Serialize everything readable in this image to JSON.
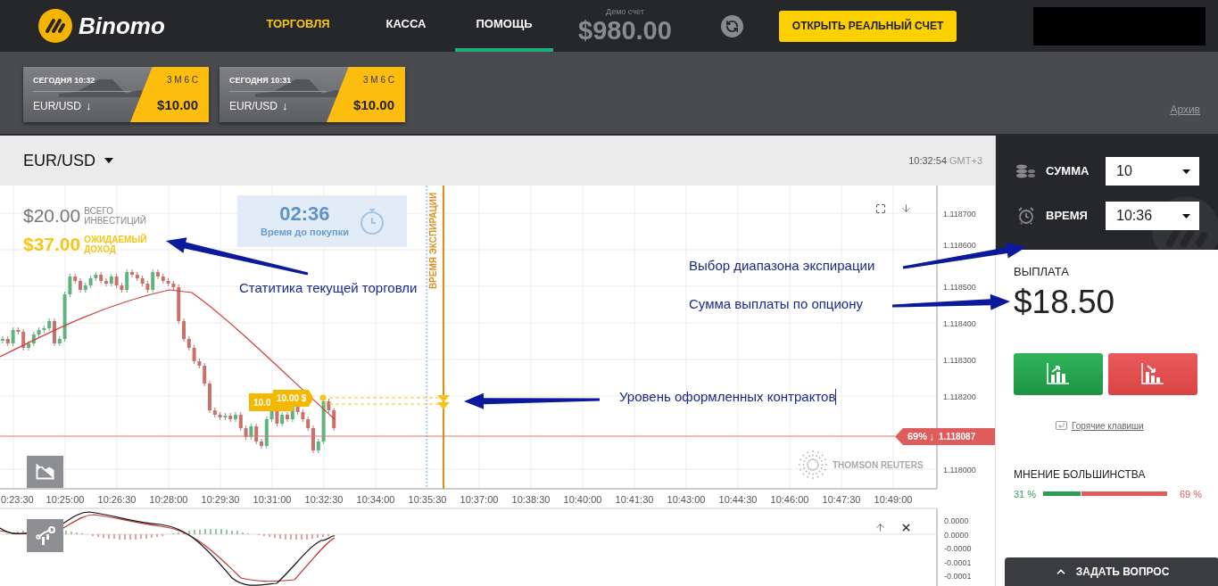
{
  "header": {
    "logo_text": "Binomo",
    "nav": [
      {
        "label": "ТОРГОВЛЯ",
        "highlighted": true,
        "selected": false
      },
      {
        "label": "КАССА",
        "highlighted": false,
        "selected": false
      },
      {
        "label": "ПОМОЩЬ",
        "highlighted": false,
        "selected": true
      }
    ],
    "account": {
      "label": "Демо счет",
      "balance": "$980.00"
    },
    "cta": "ОТКРЫТЬ РЕАЛЬНЫЙ СЧЕТ"
  },
  "open_trades": [
    {
      "time": "СЕГОДНЯ 10:32",
      "duration": "3 М 6 С",
      "asset": "EUR/USD",
      "arrow": "↓",
      "amount": "$10.00"
    },
    {
      "time": "СЕГОДНЯ 10:31",
      "duration": "3 М 6 С",
      "asset": "EUR/USD",
      "arrow": "↓",
      "amount": "$10.00"
    }
  ],
  "archive_link": "Архив",
  "chart": {
    "asset": "EUR/USD",
    "clock": "10:32:54",
    "timezone": "GMT+3",
    "investment": {
      "amount": "$20.00",
      "label": "ВСЕГО ИНВЕСТИЦИЙ"
    },
    "expected": {
      "amount": "$37.00",
      "label": "ОЖИДАЕМЫЙ ДОХОД"
    },
    "timer": {
      "value": "02:36",
      "label": "Время до покупки"
    },
    "expiry_label": "ВРЕМЯ ЭКСПИРАЦИИ",
    "contract_tags": [
      "10.0",
      "10.00 $"
    ],
    "price_tag": {
      "percent": "69%",
      "arrow": "↓",
      "price": "1.118087"
    },
    "provider": "THOMSON REUTERS",
    "price_axis": [
      "1.118700",
      "1.118600",
      "1.118500",
      "1.118400",
      "1.118300",
      "1.118200",
      "1.118000"
    ],
    "time_axis": [
      "0:23:30",
      "10:25:00",
      "10:26:30",
      "10:28:00",
      "10:29:30",
      "10:31:00",
      "10:32:30",
      "10:34:00",
      "10:35:30",
      "10:37:00",
      "10:38:30",
      "10:40:00",
      "10:41:30",
      "10:43:00",
      "10:44:30",
      "10:46:00",
      "10:47:30",
      "10:49:00"
    ],
    "indicator_axis": [
      "0.0000",
      "0.0000",
      "-0.0000",
      "-0.0001",
      "-0.0001"
    ]
  },
  "trade_panel": {
    "amount": {
      "label": "СУММА",
      "value": "10"
    },
    "time": {
      "label": "ВРЕМЯ",
      "value": "10:36"
    },
    "payout_label": "ВЫПЛАТА",
    "payout": "$18.50",
    "hotkeys": "Горячие клавиши",
    "sentiment": {
      "label": "МНЕНИЕ БОЛЬШИНСТВА",
      "up_percent": "31 %",
      "down_percent": "69 %",
      "level": 0.31
    }
  },
  "ask_button": "ЗАДАТЬ ВОПРОС",
  "annotations": [
    {
      "text": "Статитика текущей торговли"
    },
    {
      "text": "Выбор диапазона экспирации"
    },
    {
      "text": "Сумма выплаты по опциону"
    },
    {
      "text": "Уровень оформленных контрактов",
      "cursor": true
    }
  ]
}
